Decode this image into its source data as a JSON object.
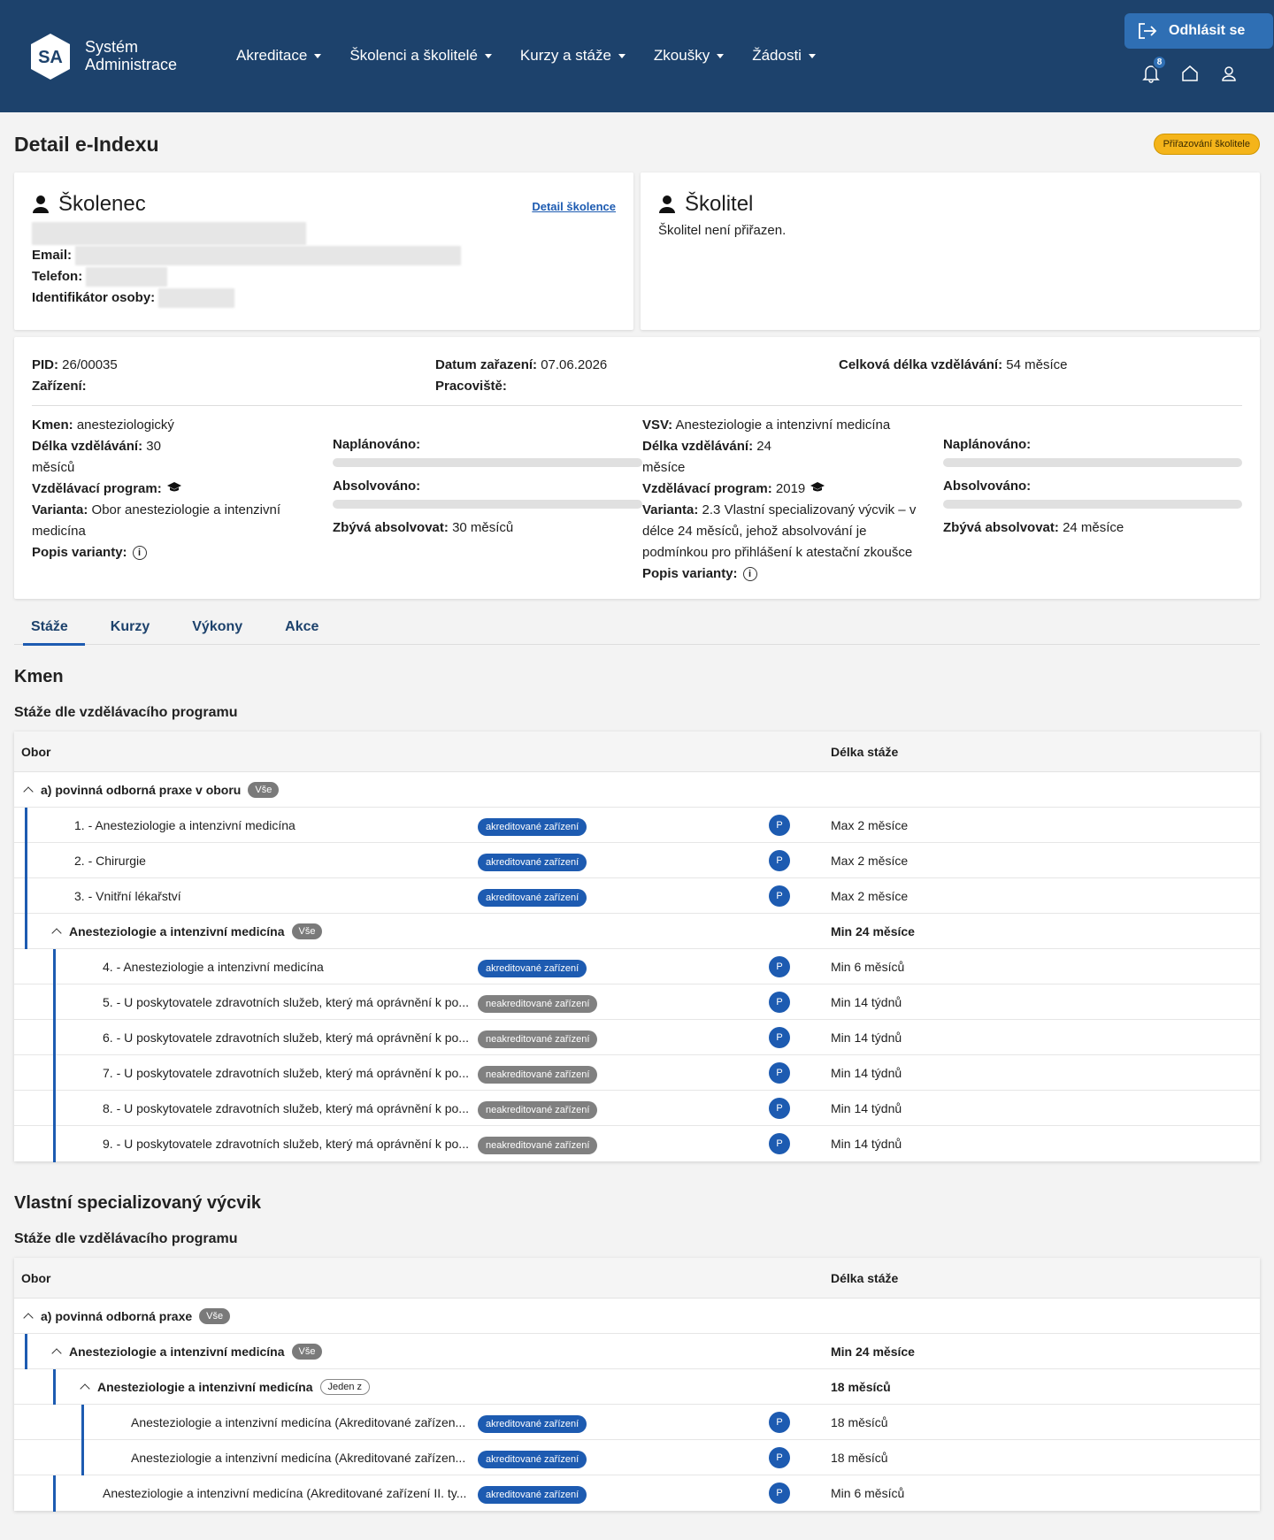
{
  "header": {
    "logo_text": "SA",
    "app_title_line1": "Systém",
    "app_title_line2": "Administrace",
    "nav": [
      "Akreditace",
      "Školenci a školitelé",
      "Kurzy a stáže",
      "Zkoušky",
      "Žádosti"
    ],
    "logout_label": "Odhlásit se",
    "notifications_count": "8"
  },
  "page": {
    "title": "Detail e-Indexu",
    "status": "Přiřazování školitele"
  },
  "trainee": {
    "heading": "Školenec",
    "detail_link": "Detail školence",
    "email_label": "Email:",
    "phone_label": "Telefon:",
    "id_label": "Identifikátor osoby:"
  },
  "supervisor": {
    "heading": "Školitel",
    "text": "Školitel není přiřazen."
  },
  "info": {
    "pid_label": "PID:",
    "pid": "26/00035",
    "date_label": "Datum zařazení:",
    "date": "07.06.2026",
    "total_label": "Celková délka vzdělávání:",
    "total": "54 měsíce",
    "facility_label": "Zařízení:",
    "workplace_label": "Pracoviště:",
    "left": {
      "kmen_label": "Kmen:",
      "kmen": "anesteziologický",
      "len_label": "Délka vzdělávání:",
      "len_a": "30",
      "len_b": "měsíců",
      "program_label": "Vzdělávací program:",
      "variant_label": "Varianta:",
      "variant_a": "Obor anesteziologie a intenzivní",
      "variant_b": "medicína",
      "desc_label": "Popis varianty:",
      "planned_label": "Naplánováno:",
      "planned_progress": 0,
      "completed_label": "Absolvováno:",
      "completed_progress": 0,
      "remaining_label": "Zbývá absolvovat:",
      "remaining": "30 měsíců"
    },
    "right": {
      "vsv_label": "VSV:",
      "vsv": "Anesteziologie a intenzivní medicína",
      "len_label": "Délka vzdělávání:",
      "len_a": "24",
      "len_b": "měsíce",
      "program_label": "Vzdělávací program:",
      "program": "2019",
      "variant_label": "Varianta:",
      "variant_a": "2.3 Vlastní specializovaný výcvik – v",
      "variant_b": "délce 24 měsíců, jehož absolvování je",
      "variant_c": "podmínkou pro přihlášení k atestační zkoušce",
      "desc_label": "Popis varianty:",
      "planned_label": "Naplánováno:",
      "planned_progress": 0,
      "completed_label": "Absolvováno:",
      "completed_progress": 0,
      "remaining_label": "Zbývá absolvovat:",
      "remaining": "24 měsíce"
    }
  },
  "tabs": [
    "Stáže",
    "Kurzy",
    "Výkony",
    "Akce"
  ],
  "section1": {
    "title": "Kmen",
    "subtitle": "Stáže dle vzdělávacího programu",
    "col_obor": "Obor",
    "col_len": "Délka stáže",
    "rows": [
      {
        "label": "a) povinná odborná praxe v oboru",
        "pill": "Vše"
      },
      {
        "label": "1. - Anesteziologie a intenzivní medicína",
        "tag": "akreditované zařízení",
        "p": "P",
        "len": "Max 2 měsíce"
      },
      {
        "label": "2. - Chirurgie",
        "tag": "akreditované zařízení",
        "p": "P",
        "len": "Max 2 měsíce"
      },
      {
        "label": "3. - Vnitřní lékařství",
        "tag": "akreditované zařízení",
        "p": "P",
        "len": "Max 2 měsíce"
      },
      {
        "label": "Anesteziologie a intenzivní medicína",
        "pill": "Vše",
        "len": "Min 24 měsíce"
      },
      {
        "label": "4. - Anesteziologie a intenzivní medicína",
        "tag": "akreditované zařízení",
        "p": "P",
        "len": "Min 6 měsíců"
      },
      {
        "label": "5. - U poskytovatele zdravotních služeb, který má oprávnění k po...",
        "tag": "neakreditované zařízení",
        "p": "P",
        "len": "Min 14 týdnů"
      },
      {
        "label": "6. - U poskytovatele zdravotních služeb, který má oprávnění k po...",
        "tag": "neakreditované zařízení",
        "p": "P",
        "len": "Min 14 týdnů"
      },
      {
        "label": "7. - U poskytovatele zdravotních služeb, který má oprávnění k po...",
        "tag": "neakreditované zařízení",
        "p": "P",
        "len": "Min 14 týdnů"
      },
      {
        "label": "8. - U poskytovatele zdravotních služeb, který má oprávnění k po...",
        "tag": "neakreditované zařízení",
        "p": "P",
        "len": "Min 14 týdnů"
      },
      {
        "label": "9. - U poskytovatele zdravotních služeb, který má oprávnění k po...",
        "tag": "neakreditované zařízení",
        "p": "P",
        "len": "Min 14 týdnů"
      }
    ]
  },
  "section2": {
    "title": "Vlastní specializovaný výcvik",
    "subtitle": "Stáže dle vzdělávacího programu",
    "col_obor": "Obor",
    "col_len": "Délka stáže",
    "rows": [
      {
        "label": "a) povinná odborná praxe",
        "pill": "Vše"
      },
      {
        "label": "Anesteziologie a intenzivní medicína",
        "pill": "Vše",
        "len": "Min 24 měsíce"
      },
      {
        "label": "Anesteziologie a intenzivní medicína",
        "pill": "Jeden z",
        "len": "18 měsíců"
      },
      {
        "label": "Anesteziologie a intenzivní medicína (Akreditované zařízen...",
        "tag": "akreditované zařízení",
        "p": "P",
        "len": "18 měsíců"
      },
      {
        "label": "Anesteziologie a intenzivní medicína (Akreditované zařízen...",
        "tag": "akreditované zařízení",
        "p": "P",
        "len": "18 měsíců"
      },
      {
        "label": "Anesteziologie a intenzivní medicína (Akreditované zařízení II. ty...",
        "tag": "akreditované zařízení",
        "p": "P",
        "len": "Min 6 měsíců"
      }
    ]
  }
}
